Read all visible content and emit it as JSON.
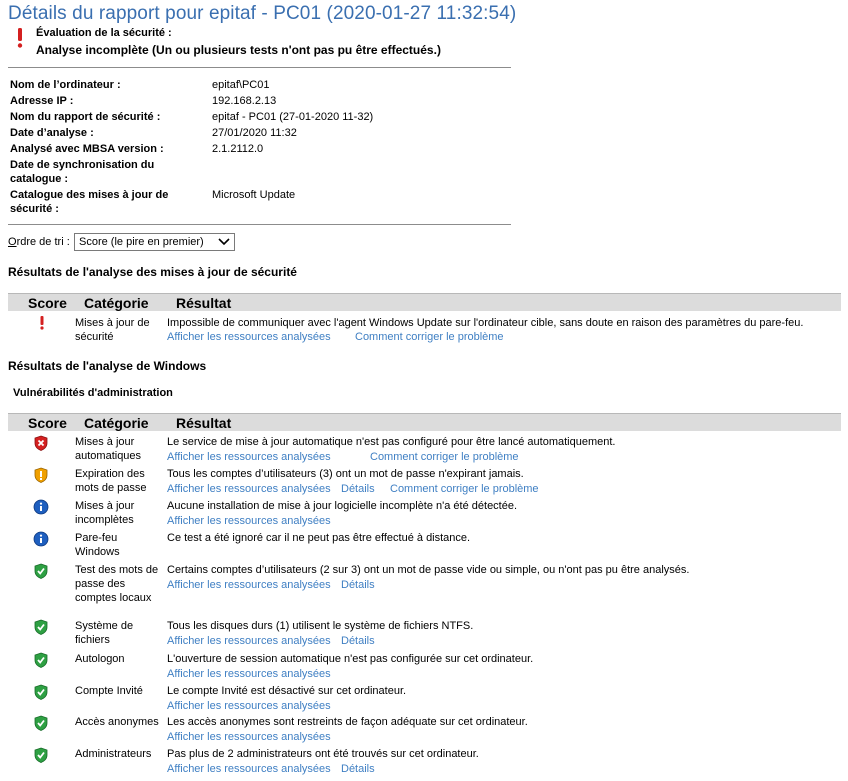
{
  "title": "Détails du rapport pour epitaf - PC01 (2020-01-27 11:32:54)",
  "assessment": {
    "label": "Évaluation de la sécurité :",
    "value": "Analyse incomplète (Un ou plusieurs tests n'ont pas pu être effectués.)"
  },
  "info": [
    {
      "label": "Nom de l’ordinateur :",
      "value": "epitaf\\PC01"
    },
    {
      "label": "Adresse IP :",
      "value": "192.168.2.13"
    },
    {
      "label": "Nom du rapport de sécurité :",
      "value": "epitaf - PC01 (27-01-2020 11-32)"
    },
    {
      "label": "Date d’analyse :",
      "value": "27/01/2020 11:32"
    },
    {
      "label": "Analysé avec MBSA version :",
      "value": "2.1.2112.0"
    },
    {
      "label": "Date de synchronisation du catalogue :",
      "value": ""
    },
    {
      "label": "Catalogue des mises à jour de sécurité :",
      "value": "Microsoft Update"
    }
  ],
  "sort": {
    "label_accel": "O",
    "label_rest": "rdre de tri :",
    "value": "Score (le pire en premier)"
  },
  "table_headers": {
    "score": "Score",
    "category": "Catégorie",
    "result": "Résultat"
  },
  "update_section": {
    "title": "Résultats de l'analyse des mises à jour de sécurité",
    "rows": [
      {
        "icon": "exclamation-icon",
        "category": "Mises à jour de sécurité",
        "result": "Impossible de communiquer avec l'agent Windows Update sur l'ordinateur cible, sans doute en raison des paramètres du pare-feu.",
        "links": [
          "Afficher les ressources analysées",
          "Comment corriger le problème"
        ]
      }
    ]
  },
  "windows_section": {
    "title": "Résultats de l'analyse de Windows",
    "subtitle": "Vulnérabilités d'administration",
    "rows": [
      {
        "icon": "critical-shield-icon",
        "category": "Mises à jour automatiques",
        "result": "Le service de mise à jour automatique n'est pas configuré pour être lancé automatiquement.",
        "links": [
          "Afficher les ressources analysées",
          "Comment corriger le problème"
        ]
      },
      {
        "icon": "warning-shield-icon",
        "category": "Expiration des mots de passe",
        "result": "Tous les comptes d’utilisateurs (3) ont un mot de passe n'expirant jamais.",
        "links": [
          "Afficher les ressources analysées",
          "Détails",
          "Comment corriger le problème"
        ]
      },
      {
        "icon": "info-icon",
        "category": "Mises à jour incomplètes",
        "result": "Aucune installation de mise à jour logicielle incomplète n'a été détectée.",
        "links": [
          "Afficher les ressources analysées"
        ]
      },
      {
        "icon": "info-icon",
        "category": "Pare-feu Windows",
        "result": "Ce test a été ignoré car il ne peut pas être effectué à distance.",
        "links": []
      },
      {
        "icon": "ok-shield-icon",
        "category": "Test des mots de passe des comptes locaux",
        "result": "Certains comptes d’utilisateurs (2 sur 3) ont un mot de passe vide ou simple, ou n'ont pas pu être analysés.",
        "links": [
          "Afficher les ressources analysées",
          "Détails"
        ]
      },
      {
        "icon": "ok-shield-icon",
        "category": "Système de fichiers",
        "result": "Tous les disques durs (1) utilisent le système de fichiers NTFS.",
        "links": [
          "Afficher les ressources analysées",
          "Détails"
        ]
      },
      {
        "icon": "ok-shield-icon",
        "category": "Autologon",
        "result": "L'ouverture de session automatique n'est pas configurée sur cet ordinateur.",
        "links": [
          "Afficher les ressources analysées"
        ]
      },
      {
        "icon": "ok-shield-icon",
        "category": "Compte Invité",
        "result": "Le compte Invité est désactivé sur cet ordinateur.",
        "links": [
          "Afficher les ressources analysées"
        ]
      },
      {
        "icon": "ok-shield-icon",
        "category": "Accès anonymes",
        "result": "Les accès anonymes sont restreints de façon adéquate sur cet ordinateur.",
        "links": [
          "Afficher les ressources analysées"
        ]
      },
      {
        "icon": "ok-shield-icon",
        "category": "Administrateurs",
        "result": "Pas plus de 2 administrateurs ont été trouvés sur cet ordinateur.",
        "links": [
          "Afficher les ressources analysées",
          "Détails"
        ]
      }
    ]
  },
  "colors": {
    "title": "#3a6fb0",
    "link": "#3f7fc3",
    "critical": "#d42020",
    "warning": "#f0a000",
    "ok": "#2ea043",
    "info": "#1e5fbf"
  }
}
